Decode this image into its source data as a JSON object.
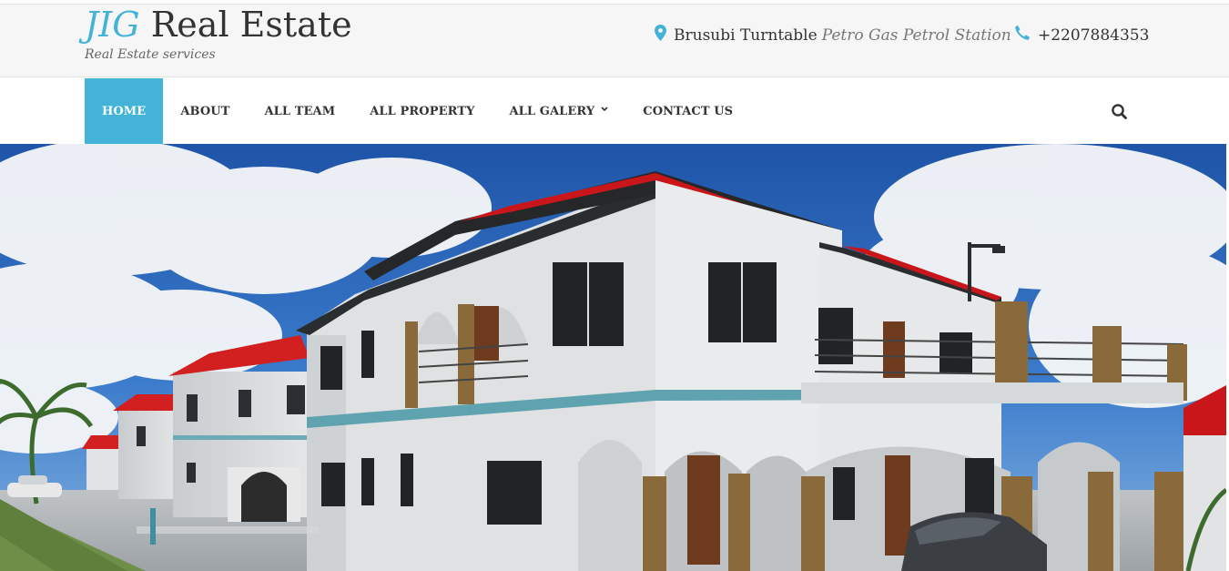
{
  "brand": {
    "accent": "JIG",
    "name": " Real Estate",
    "tagline": "Real Estate services"
  },
  "contact": {
    "address_icon": "map-marker-icon",
    "address": "Brusubi Turntable",
    "address_detail": "Petro Gas Petrol Station",
    "phone_icon": "phone-icon",
    "phone": "+2207884353"
  },
  "nav": {
    "items": [
      {
        "label": "HOME",
        "active": true
      },
      {
        "label": "ABOUT"
      },
      {
        "label": "ALL TEAM"
      },
      {
        "label": "ALL PROPERTY"
      },
      {
        "label": "ALL GALERY",
        "has_dropdown": true
      },
      {
        "label": "CONTACT US"
      }
    ],
    "search_icon": "search-icon"
  },
  "hero": {
    "image": "two-storey white villa row with red roofs under blue cloudy sky"
  },
  "colors": {
    "accent": "#44b3d8",
    "header_bg": "#f6f6f6",
    "text": "#333333"
  }
}
